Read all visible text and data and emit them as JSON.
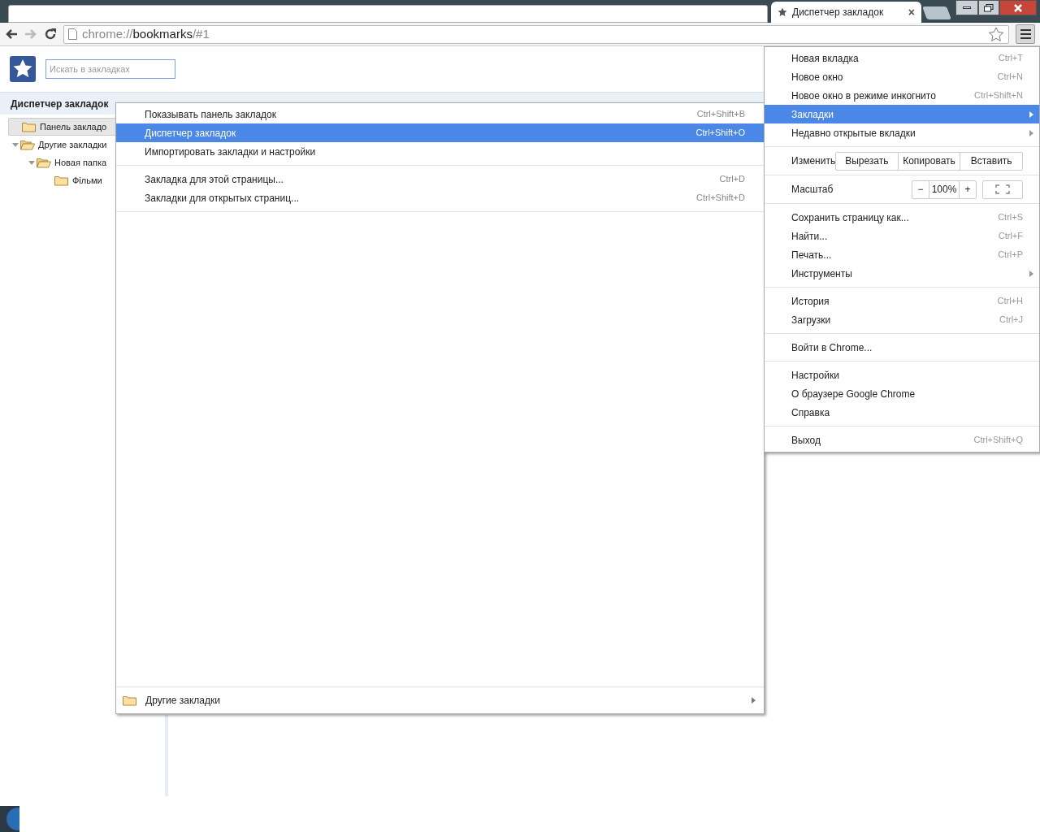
{
  "tab": {
    "title": "Диспетчер закладок",
    "close": "×"
  },
  "address": {
    "scheme": "chrome://",
    "host": "bookmarks",
    "path": "/#1"
  },
  "search": {
    "placeholder": "Искать в закладках"
  },
  "page_title": "Диспетчер закладок",
  "tree": [
    {
      "label": "Панель закладо",
      "selected": true,
      "expanded": false
    },
    {
      "label": "Другие закладки",
      "selected": false,
      "expanded": true,
      "children": [
        {
          "label": "Новая папка",
          "selected": false,
          "expanded": true,
          "children": [
            {
              "label": "Фільми",
              "selected": false,
              "expanded": false
            }
          ]
        }
      ]
    }
  ],
  "bookmarks_menu": {
    "items": [
      {
        "kind": "item",
        "label": "Показывать панель закладок",
        "shortcut": "Ctrl+Shift+B",
        "selected": false
      },
      {
        "kind": "item",
        "label": "Диспетчер закладок",
        "shortcut": "Ctrl+Shift+O",
        "selected": true
      },
      {
        "kind": "item",
        "label": "Импортировать закладки и настройки",
        "selected": false
      },
      {
        "kind": "separator"
      },
      {
        "kind": "item",
        "label": "Закладка для этой страницы...",
        "shortcut": "Ctrl+D",
        "selected": false
      },
      {
        "kind": "item",
        "label": "Закладки для открытых страниц...",
        "shortcut": "Ctrl+Shift+D",
        "selected": false
      },
      {
        "kind": "separator"
      }
    ],
    "footer": {
      "label": "Другие закладки"
    }
  },
  "chrome_menu": [
    {
      "kind": "item",
      "label": "Новая вкладка",
      "shortcut": "Ctrl+T",
      "selected": false
    },
    {
      "kind": "item",
      "label": "Новое окно",
      "shortcut": "Ctrl+N",
      "selected": false
    },
    {
      "kind": "item",
      "label": "Новое окно в режиме инкогнито",
      "shortcut": "Ctrl+Shift+N",
      "selected": false
    },
    {
      "kind": "submenu",
      "label": "Закладки",
      "selected": true
    },
    {
      "kind": "submenu",
      "label": "Недавно открытые вкладки",
      "selected": false
    },
    {
      "kind": "separator"
    },
    {
      "kind": "edit",
      "label": "Изменить",
      "buttons": [
        "Вырезать",
        "Копировать",
        "Вставить"
      ]
    },
    {
      "kind": "separator"
    },
    {
      "kind": "zoom",
      "label": "Масштаб",
      "minus": "−",
      "value": "100%",
      "plus": "+"
    },
    {
      "kind": "separator"
    },
    {
      "kind": "item",
      "label": "Сохранить страницу как...",
      "shortcut": "Ctrl+S",
      "selected": false
    },
    {
      "kind": "item",
      "label": "Найти...",
      "shortcut": "Ctrl+F",
      "selected": false
    },
    {
      "kind": "item",
      "label": "Печать...",
      "shortcut": "Ctrl+P",
      "selected": false
    },
    {
      "kind": "submenu",
      "label": "Инструменты",
      "selected": false
    },
    {
      "kind": "separator"
    },
    {
      "kind": "item",
      "label": "История",
      "shortcut": "Ctrl+H",
      "selected": false
    },
    {
      "kind": "item",
      "label": "Загрузки",
      "shortcut": "Ctrl+J",
      "selected": false
    },
    {
      "kind": "separator"
    },
    {
      "kind": "item",
      "label": "Войти в Chrome...",
      "selected": false
    },
    {
      "kind": "separator"
    },
    {
      "kind": "item",
      "label": "Настройки",
      "selected": false
    },
    {
      "kind": "item",
      "label": "О браузере Google Chrome",
      "selected": false
    },
    {
      "kind": "item",
      "label": "Справка",
      "selected": false
    },
    {
      "kind": "separator"
    },
    {
      "kind": "item",
      "label": "Выход",
      "shortcut": "Ctrl+Shift+Q",
      "selected": false
    }
  ]
}
